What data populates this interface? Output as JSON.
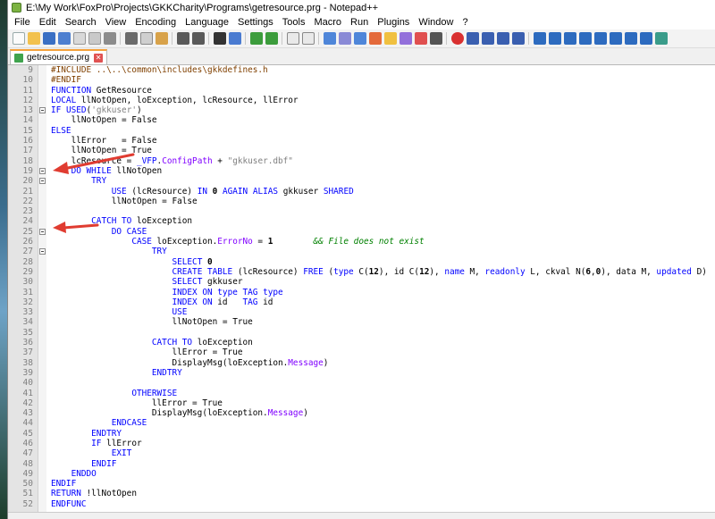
{
  "window": {
    "title": "E:\\My Work\\FoxPro\\Projects\\GKKCharity\\Programs\\getresource.prg - Notepad++"
  },
  "menu": [
    "File",
    "Edit",
    "Search",
    "View",
    "Encoding",
    "Language",
    "Settings",
    "Tools",
    "Macro",
    "Run",
    "Plugins",
    "Window",
    "?"
  ],
  "tab": {
    "label": "getresource.prg"
  },
  "colors": {
    "keyword": "#0000ff",
    "comment": "#008000",
    "property": "#8000ff",
    "annotation_arrow": "#e03c31"
  },
  "lines": [
    {
      "n": "9",
      "segs": [
        [
          "pre",
          "#INCLUDE ..\\..\\common\\includes\\gkkdefines.h"
        ]
      ]
    },
    {
      "n": "10",
      "segs": [
        [
          "pre",
          "#ENDIF"
        ]
      ]
    },
    {
      "n": "11",
      "segs": [
        [
          "kw",
          "FUNCTION"
        ],
        [
          "",
          " GetResource"
        ]
      ]
    },
    {
      "n": "12",
      "segs": [
        [
          "kw",
          "LOCAL"
        ],
        [
          "",
          " llNotOpen, loException, lcResource, llError"
        ]
      ]
    },
    {
      "n": "13",
      "segs": [
        [
          "kw",
          "IF"
        ],
        [
          "",
          " "
        ],
        [
          "kw",
          "USED"
        ],
        [
          "",
          "("
        ],
        [
          "str",
          "'gkkuser'"
        ],
        [
          "",
          ")"
        ]
      ]
    },
    {
      "n": "14",
      "segs": [
        [
          "",
          "    llNotOpen = False"
        ]
      ]
    },
    {
      "n": "15",
      "segs": [
        [
          "kw",
          "ELSE"
        ]
      ]
    },
    {
      "n": "16",
      "segs": [
        [
          "",
          "    llError   = False"
        ]
      ]
    },
    {
      "n": "17",
      "segs": [
        [
          "",
          "    llNotOpen = True"
        ]
      ]
    },
    {
      "n": "18",
      "segs": [
        [
          "",
          "    lcResource = "
        ],
        [
          "kw",
          "_VFP"
        ],
        [
          "",
          "."
        ],
        [
          "prop",
          "ConfigPath"
        ],
        [
          "",
          " + "
        ],
        [
          "str",
          "\"gkkuser.dbf\""
        ]
      ]
    },
    {
      "n": "19",
      "segs": [
        [
          "",
          "    "
        ],
        [
          "kw",
          "DO WHILE"
        ],
        [
          "",
          " llNotOpen"
        ]
      ]
    },
    {
      "n": "20",
      "segs": [
        [
          "",
          "        "
        ],
        [
          "kw",
          "TRY"
        ]
      ]
    },
    {
      "n": "21",
      "segs": [
        [
          "",
          "            "
        ],
        [
          "kw",
          "USE"
        ],
        [
          "",
          " (lcResource) "
        ],
        [
          "kw",
          "IN"
        ],
        [
          "",
          " "
        ],
        [
          "num",
          "0"
        ],
        [
          "",
          " "
        ],
        [
          "kw",
          "AGAIN ALIAS"
        ],
        [
          "",
          " gkkuser "
        ],
        [
          "kw",
          "SHARED"
        ]
      ]
    },
    {
      "n": "22",
      "segs": [
        [
          "",
          "            llNotOpen = False"
        ]
      ]
    },
    {
      "n": "23",
      "segs": [
        [
          "",
          ""
        ]
      ]
    },
    {
      "n": "24",
      "segs": [
        [
          "",
          "        "
        ],
        [
          "kw",
          "CATCH TO"
        ],
        [
          "",
          " loException"
        ]
      ]
    },
    {
      "n": "25",
      "segs": [
        [
          "",
          "            "
        ],
        [
          "kw",
          "DO CASE"
        ]
      ]
    },
    {
      "n": "26",
      "segs": [
        [
          "",
          "                "
        ],
        [
          "kw",
          "CASE"
        ],
        [
          "",
          " loException."
        ],
        [
          "prop",
          "ErrorNo"
        ],
        [
          "",
          " = "
        ],
        [
          "num",
          "1"
        ],
        [
          "",
          "        "
        ],
        [
          "cmt",
          "&& File does not exist"
        ]
      ]
    },
    {
      "n": "27",
      "segs": [
        [
          "",
          "                    "
        ],
        [
          "kw",
          "TRY"
        ]
      ]
    },
    {
      "n": "28",
      "segs": [
        [
          "",
          "                        "
        ],
        [
          "kw",
          "SELECT"
        ],
        [
          "",
          " "
        ],
        [
          "num",
          "0"
        ]
      ]
    },
    {
      "n": "29",
      "segs": [
        [
          "",
          "                        "
        ],
        [
          "kw",
          "CREATE TABLE"
        ],
        [
          "",
          " (lcResource) "
        ],
        [
          "kw",
          "FREE"
        ],
        [
          "",
          " ("
        ],
        [
          "kw",
          "type"
        ],
        [
          "",
          " C("
        ],
        [
          "num",
          "12"
        ],
        [
          "",
          "), id C("
        ],
        [
          "num",
          "12"
        ],
        [
          "",
          "), "
        ],
        [
          "kw",
          "name"
        ],
        [
          "",
          " M, "
        ],
        [
          "kw",
          "readonly"
        ],
        [
          "",
          " L, ckval N("
        ],
        [
          "num",
          "6"
        ],
        [
          "",
          ","
        ],
        [
          "num",
          "0"
        ],
        [
          "",
          "), data M, "
        ],
        [
          "kw",
          "updated"
        ],
        [
          "",
          " D)"
        ]
      ]
    },
    {
      "n": "30",
      "segs": [
        [
          "",
          "                        "
        ],
        [
          "kw",
          "SELECT"
        ],
        [
          "",
          " gkkuser"
        ]
      ]
    },
    {
      "n": "31",
      "segs": [
        [
          "",
          "                        "
        ],
        [
          "kw",
          "INDEX ON"
        ],
        [
          "",
          " "
        ],
        [
          "kw",
          "type"
        ],
        [
          "",
          " "
        ],
        [
          "kw",
          "TAG"
        ],
        [
          "",
          " "
        ],
        [
          "kw",
          "type"
        ]
      ]
    },
    {
      "n": "32",
      "segs": [
        [
          "",
          "                        "
        ],
        [
          "kw",
          "INDEX ON"
        ],
        [
          "",
          " id   "
        ],
        [
          "kw",
          "TAG"
        ],
        [
          "",
          " id"
        ]
      ]
    },
    {
      "n": "33",
      "segs": [
        [
          "",
          "                        "
        ],
        [
          "kw",
          "USE"
        ]
      ]
    },
    {
      "n": "34",
      "segs": [
        [
          "",
          "                        llNotOpen = True"
        ]
      ]
    },
    {
      "n": "35",
      "segs": [
        [
          "",
          ""
        ]
      ]
    },
    {
      "n": "36",
      "segs": [
        [
          "",
          "                    "
        ],
        [
          "kw",
          "CATCH TO"
        ],
        [
          "",
          " loException"
        ]
      ]
    },
    {
      "n": "37",
      "segs": [
        [
          "",
          "                        llError = True"
        ]
      ]
    },
    {
      "n": "38",
      "segs": [
        [
          "",
          "                        DisplayMsg(loException."
        ],
        [
          "prop",
          "Message"
        ],
        [
          "",
          ")"
        ]
      ]
    },
    {
      "n": "39",
      "segs": [
        [
          "",
          "                    "
        ],
        [
          "kw",
          "ENDTRY"
        ]
      ]
    },
    {
      "n": "40",
      "segs": [
        [
          "",
          ""
        ]
      ]
    },
    {
      "n": "41",
      "segs": [
        [
          "",
          "                "
        ],
        [
          "kw",
          "OTHERWISE"
        ]
      ]
    },
    {
      "n": "42",
      "segs": [
        [
          "",
          "                    llError = True"
        ]
      ]
    },
    {
      "n": "43",
      "segs": [
        [
          "",
          "                    DisplayMsg(loException."
        ],
        [
          "prop",
          "Message"
        ],
        [
          "",
          ")"
        ]
      ]
    },
    {
      "n": "44",
      "segs": [
        [
          "",
          "            "
        ],
        [
          "kw",
          "ENDCASE"
        ]
      ]
    },
    {
      "n": "45",
      "segs": [
        [
          "",
          "        "
        ],
        [
          "kw",
          "ENDTRY"
        ]
      ]
    },
    {
      "n": "46",
      "segs": [
        [
          "",
          "        "
        ],
        [
          "kw",
          "IF"
        ],
        [
          "",
          " llError"
        ]
      ]
    },
    {
      "n": "47",
      "segs": [
        [
          "",
          "            "
        ],
        [
          "kw",
          "EXIT"
        ]
      ]
    },
    {
      "n": "48",
      "segs": [
        [
          "",
          "        "
        ],
        [
          "kw",
          "ENDIF"
        ]
      ]
    },
    {
      "n": "49",
      "segs": [
        [
          "",
          "    "
        ],
        [
          "kw",
          "ENDDO"
        ]
      ]
    },
    {
      "n": "50",
      "segs": [
        [
          "kw",
          "ENDIF"
        ]
      ]
    },
    {
      "n": "51",
      "segs": [
        [
          "kw",
          "RETURN"
        ],
        [
          "",
          " !llNotOpen"
        ]
      ]
    },
    {
      "n": "52",
      "segs": [
        [
          "kw",
          "ENDFUNC"
        ]
      ]
    }
  ],
  "fold_lines": [
    "13",
    "19",
    "20",
    "25",
    "27"
  ]
}
